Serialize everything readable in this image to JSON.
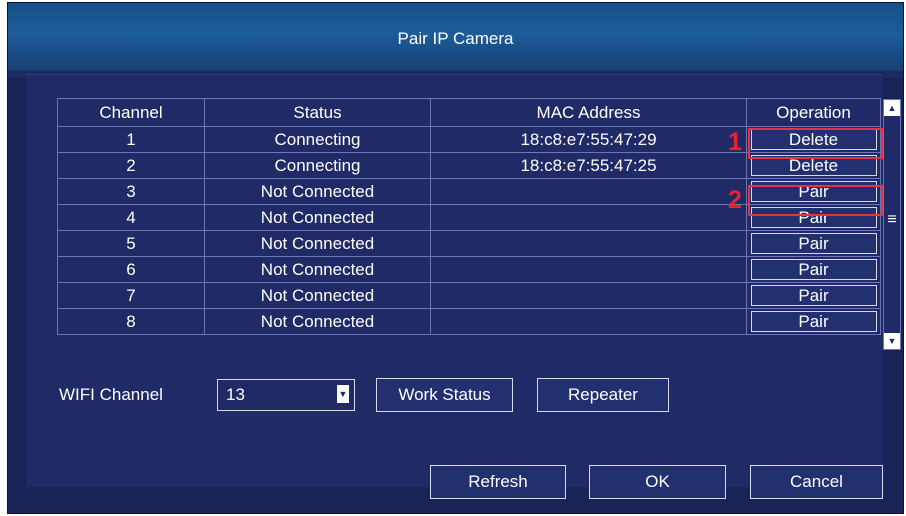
{
  "dialog": {
    "title": "Pair IP Camera"
  },
  "table": {
    "headers": [
      "Channel",
      "Status",
      "MAC Address",
      "Operation"
    ],
    "rows": [
      {
        "channel": "1",
        "status": "Connecting",
        "mac": "18:c8:e7:55:47:29",
        "operation": "Delete"
      },
      {
        "channel": "2",
        "status": "Connecting",
        "mac": "18:c8:e7:55:47:25",
        "operation": "Delete"
      },
      {
        "channel": "3",
        "status": "Not Connected",
        "mac": "",
        "operation": "Pair"
      },
      {
        "channel": "4",
        "status": "Not Connected",
        "mac": "",
        "operation": "Pair"
      },
      {
        "channel": "5",
        "status": "Not Connected",
        "mac": "",
        "operation": "Pair"
      },
      {
        "channel": "6",
        "status": "Not Connected",
        "mac": "",
        "operation": "Pair"
      },
      {
        "channel": "7",
        "status": "Not Connected",
        "mac": "",
        "operation": "Pair"
      },
      {
        "channel": "8",
        "status": "Not Connected",
        "mac": "",
        "operation": "Pair"
      }
    ]
  },
  "annotations": {
    "marker1": "1",
    "marker2": "2",
    "color": "#e8222e"
  },
  "wifi": {
    "label": "WIFI Channel",
    "value": "13"
  },
  "buttons": {
    "work_status": "Work Status",
    "repeater": "Repeater",
    "refresh": "Refresh",
    "ok": "OK",
    "cancel": "Cancel"
  },
  "icons": {
    "scroll_up": "scroll-up-arrow-icon",
    "scroll_down": "scroll-down-arrow-icon",
    "scroll_grip": "scroll-thumb-grip-icon",
    "dropdown": "dropdown-arrow-icon"
  },
  "colors": {
    "background": "#1f2a66",
    "title_bar": "#1c5c9a",
    "grid_line": "#6a77b4",
    "highlight": "#e33243"
  }
}
